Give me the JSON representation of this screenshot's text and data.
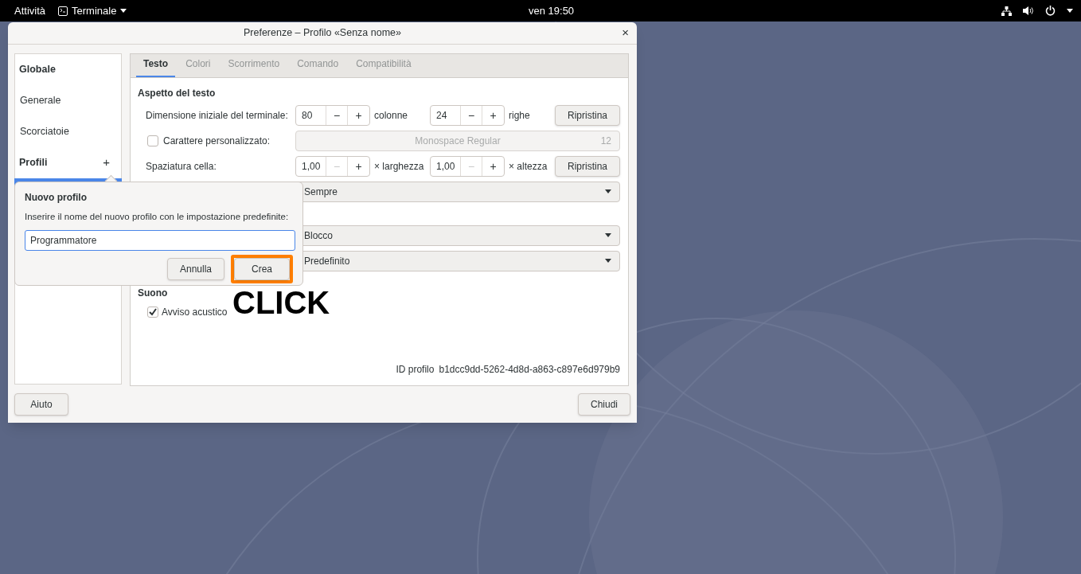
{
  "top_bar": {
    "activities": "Attività",
    "app_menu": "Terminale",
    "clock": "ven 19:50"
  },
  "window": {
    "title": "Preferenze – Profilo «Senza nome»",
    "close": "×"
  },
  "sidebar": {
    "items": [
      {
        "kind": "header",
        "label": "Globale",
        "selected": false
      },
      {
        "kind": "item",
        "label": "Generale",
        "selected": false
      },
      {
        "kind": "item",
        "label": "Scorciatoie",
        "selected": false
      },
      {
        "kind": "header",
        "label": "Profili",
        "add": "+",
        "selected": false
      },
      {
        "kind": "profile",
        "selected": true
      }
    ]
  },
  "tabs": [
    {
      "label": "Testo",
      "selected": true
    },
    {
      "label": "Colori",
      "selected": false
    },
    {
      "label": "Scorrimento",
      "selected": false
    },
    {
      "label": "Comando",
      "selected": false
    },
    {
      "label": "Compatibilità",
      "selected": false
    }
  ],
  "section_heading": "Aspetto del testo",
  "rows": [
    {
      "kind": "spins",
      "label": "Dimensione iniziale del terminale:",
      "spins": [
        {
          "value": "80",
          "minus": "−",
          "plus": "+",
          "minus_disabled": false,
          "unit": "colonne"
        },
        {
          "value": "24",
          "minus": "−",
          "plus": "+",
          "minus_disabled": false,
          "unit": "righe"
        }
      ],
      "button": "Ripristina"
    },
    {
      "kind": "font",
      "label": "Carattere personalizzato:",
      "checked": false,
      "font": "Monospace Regular",
      "size": "12",
      "disabled": true
    },
    {
      "kind": "spins",
      "label": "Spaziatura cella:",
      "spins": [
        {
          "value": "1,00",
          "minus": "−",
          "plus": "+",
          "minus_disabled": true,
          "unit": "× larghezza"
        },
        {
          "value": "1,00",
          "minus": "−",
          "plus": "+",
          "minus_disabled": true,
          "unit": "× altezza"
        }
      ],
      "button": "Ripristina"
    },
    {
      "kind": "dropdown",
      "value": "Sempre"
    },
    {
      "kind": "gap"
    },
    {
      "kind": "dropdown",
      "value": "Blocco"
    },
    {
      "kind": "dropdown",
      "value": "Predefinito"
    }
  ],
  "sound": {
    "heading": "Suono",
    "checkbox": {
      "label": "Avviso acustico",
      "checked": true
    }
  },
  "profile_id": {
    "label": "ID profilo",
    "value": "b1dcc9dd-5262-4d8d-a863-c897e6d979b9"
  },
  "footer": {
    "help": "Aiuto",
    "close": "Chiudi"
  },
  "popover": {
    "title": "Nuovo profilo",
    "prompt": "Inserire il nome del nuovo profilo con le impostazione predefinite:",
    "value": "Programmatore",
    "buttons": [
      {
        "label": "Annulla",
        "highlighted": false
      },
      {
        "label": "Crea",
        "highlighted": true
      }
    ]
  },
  "annotation": {
    "text": "CLICK"
  }
}
